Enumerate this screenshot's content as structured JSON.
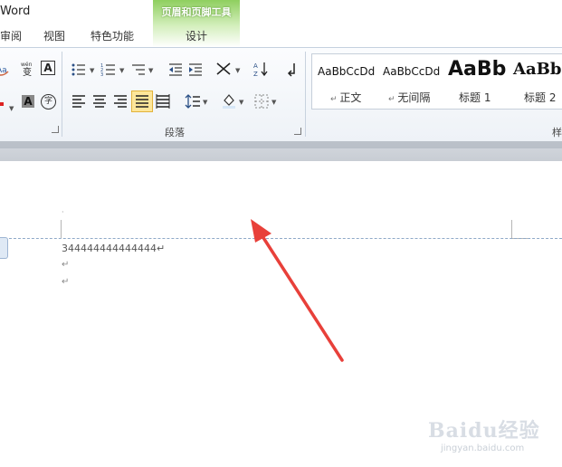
{
  "window": {
    "title": "Word"
  },
  "tabs": [
    {
      "label": "审阅"
    },
    {
      "label": "视图"
    },
    {
      "label": "特色功能"
    }
  ],
  "context_tab": {
    "group_title": "页眉和页脚工具",
    "tab_label": "设计"
  },
  "ribbon": {
    "groups": {
      "paragraph": "段落",
      "styles": "样"
    },
    "font_group": {
      "phonetic_icon_text": "wén",
      "phonetic_icon_char": "变",
      "char_border": "A",
      "char_shading": "A",
      "enclose": "字"
    },
    "styles": [
      {
        "sample": "AaBbCcDd",
        "name": "正文"
      },
      {
        "sample": "AaBbCcDd",
        "name": "无间隔"
      },
      {
        "sample": "AaBb",
        "name": "标题 1"
      },
      {
        "sample": "AaBb(",
        "name": "标题 2"
      }
    ]
  },
  "document": {
    "body_line": "344444444444444↵",
    "para_mark": "↵"
  },
  "watermark": {
    "brand": "Baidu经验",
    "url": "jingyan.baidu.com"
  },
  "colors": {
    "context_tab": "#8fcf5f",
    "arrow": "#e8403a",
    "header_line": "#8fa9c8",
    "ribbon_bg": "#eef2f7"
  }
}
